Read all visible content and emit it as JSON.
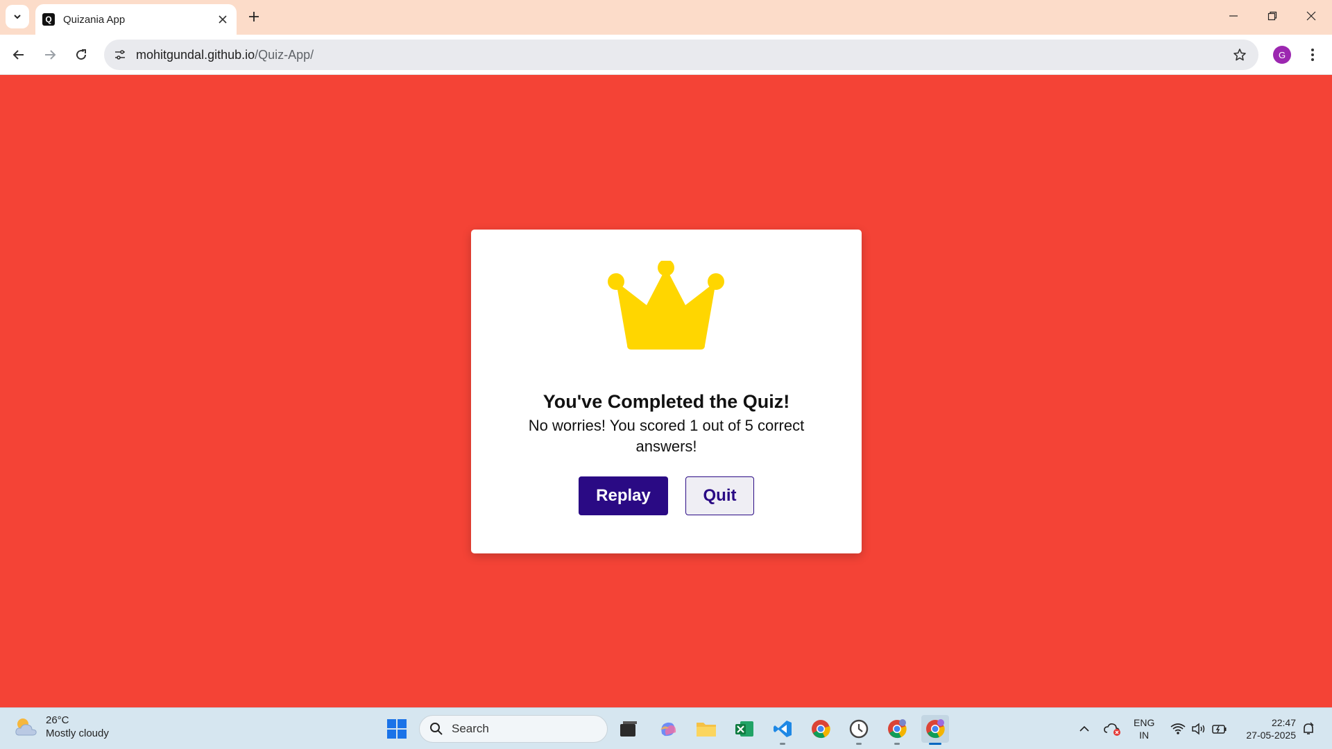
{
  "browser": {
    "tab_title": "Quizania App",
    "url_domain": "mohitgundal.github.io",
    "url_path": "/Quiz-App/",
    "profile_initial": "G"
  },
  "quiz_result": {
    "title": "You've Completed the Quiz!",
    "message": "No worries! You scored 1 out of 5 correct answers!",
    "replay_label": "Replay",
    "quit_label": "Quit",
    "score": 1,
    "total": 5
  },
  "taskbar": {
    "weather_temp": "26°C",
    "weather_desc": "Mostly cloudy",
    "search_placeholder": "Search",
    "lang_top": "ENG",
    "lang_bottom": "IN",
    "time": "22:47",
    "date": "27-05-2025"
  },
  "colors": {
    "page_background": "#f44336",
    "primary_button": "#2a0a84",
    "crown": "#ffd600"
  }
}
